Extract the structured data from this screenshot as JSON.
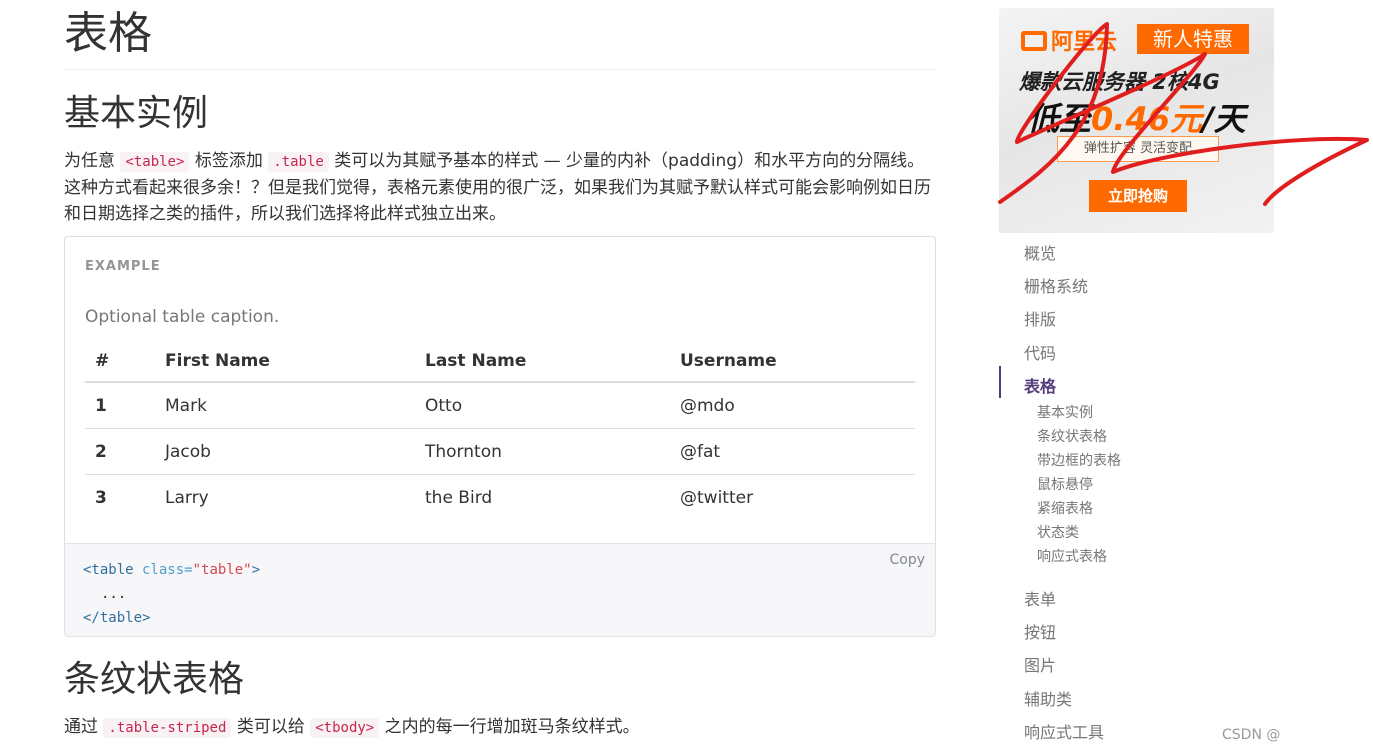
{
  "page": {
    "title": "表格",
    "basic_heading": "基本实例",
    "intro_parts": {
      "p1": "为任意 ",
      "code1": "<table>",
      "p2": " 标签添加 ",
      "code2": ".table",
      "p3": " 类可以为其赋予基本的样式 — 少量的内补（padding）和水平方向的分隔线。这种方式看起来很多余！？但是我们觉得，表格元素使用的很广泛，如果我们为其赋予默认样式可能会影响例如日历和日期选择之类的插件，所以我们选择将此样式独立出来。"
    },
    "example_label": "EXAMPLE",
    "caption": "Optional table caption.",
    "table": {
      "headers": [
        "#",
        "First Name",
        "Last Name",
        "Username"
      ],
      "rows": [
        [
          "1",
          "Mark",
          "Otto",
          "@mdo"
        ],
        [
          "2",
          "Jacob",
          "Thornton",
          "@fat"
        ],
        [
          "3",
          "Larry",
          "the Bird",
          "@twitter"
        ]
      ]
    },
    "code": {
      "copy_label": "Copy",
      "tag_open": "<table",
      "attr_name": " class=",
      "attr_value": "\"table\"",
      "tag_close": ">",
      "ellipsis": "...",
      "end_tag": "</table>"
    },
    "striped_heading": "条纹状表格",
    "striped_parts": {
      "p1": "通过 ",
      "code1": ".table-striped",
      "p2": " 类可以给 ",
      "code2": "<tbody>",
      "p3": " 之内的每一行增加斑马条纹样式。"
    }
  },
  "ad": {
    "brand": "阿里云",
    "badge": "新人特惠",
    "line1": "爆款云服务器 2核4G",
    "line2_prefix": "低至",
    "price": "0.46元",
    "line2_suffix": "/天",
    "tag": "弹性扩容 灵活变配",
    "button": "立即抢购"
  },
  "sidebar": {
    "items": [
      "概览",
      "栅格系统",
      "排版",
      "代码",
      "表格",
      "表单",
      "按钮",
      "图片",
      "辅助类",
      "响应式工具"
    ],
    "active": "表格",
    "sub_items": [
      "基本实例",
      "条纹状表格",
      "带边框的表格",
      "鼠标悬停",
      "紧缩表格",
      "状态类",
      "响应式表格"
    ]
  },
  "watermark": "CSDN @"
}
